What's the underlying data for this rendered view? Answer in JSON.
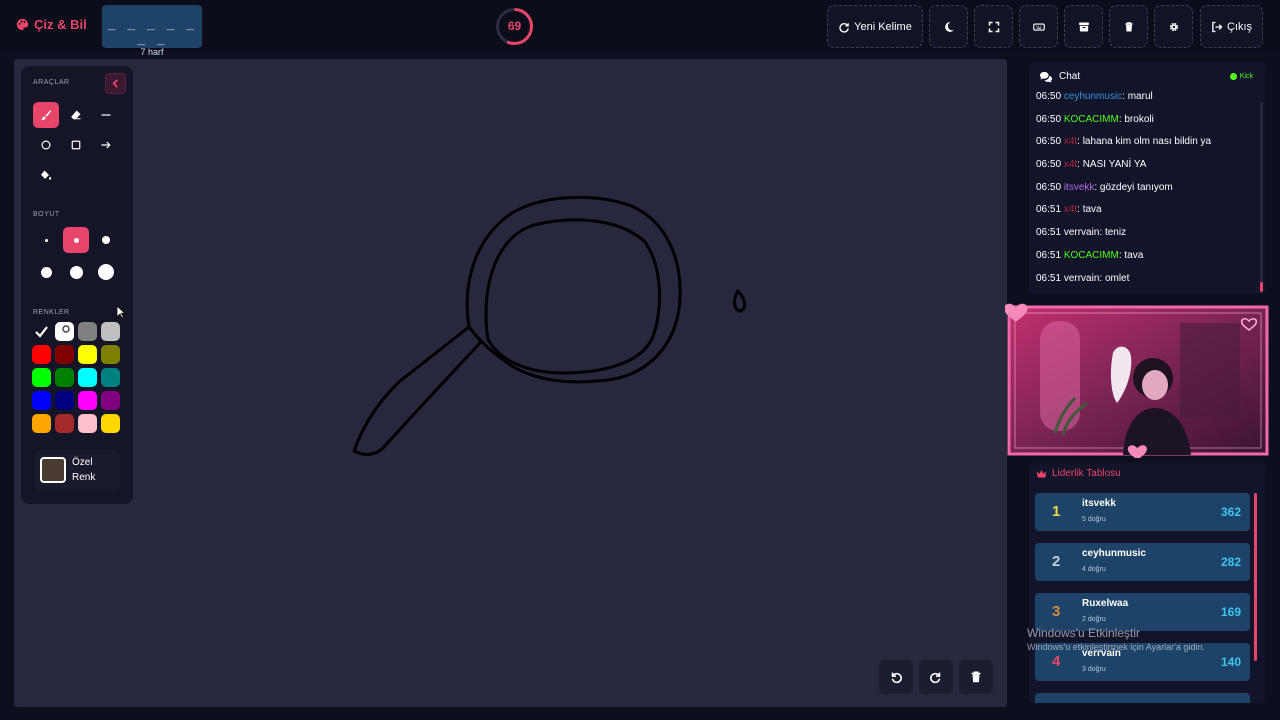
{
  "app": {
    "title": "Çiz & Bil",
    "word_dashes": "_ _ _ _ _ _ _",
    "word_length": "7 harf",
    "timer_value": "69",
    "timer_progress": 0.57
  },
  "toolbar": {
    "new_word_label": "Yeni Kelime",
    "exit_label": "Çıkış",
    "buttons": [
      "refresh-icon",
      "moon-icon",
      "fullscreen-icon",
      "keyboard-icon",
      "archive-icon",
      "trash-icon",
      "gear-icon",
      "sign-out-icon"
    ]
  },
  "tools_panel": {
    "tools_label": "ARAÇLAR",
    "size_label": "BOYUT",
    "colors_label": "RENKLER",
    "custom_color_line1": "Özel",
    "custom_color_line2": "Renk",
    "tools": [
      "brush-icon",
      "eraser-icon",
      "line-icon",
      "circle-icon",
      "square-icon",
      "arrow-icon",
      "fill-icon"
    ],
    "active_tool": "brush",
    "sizes": [
      2,
      4,
      7,
      10,
      12,
      15
    ],
    "active_size": 4,
    "colors": [
      "#000000",
      "#ffffff",
      "#808080",
      "#c0c0c0",
      "#ff0000",
      "#800000",
      "#ffff00",
      "#808000",
      "#00ff00",
      "#008000",
      "#00ffff",
      "#008080",
      "#0000ff",
      "#000080",
      "#ff00ff",
      "#800080",
      "#ffa500",
      "#a52a2a",
      "#ffc0cb",
      "#ffd700"
    ],
    "selected_color": "#000000",
    "custom_color": "#4a3c32"
  },
  "canvas": {
    "background": "#27283d",
    "stroke_color": "#000000"
  },
  "chat": {
    "title": "Chat",
    "platform": "Kick",
    "messages": [
      {
        "time": "06:50",
        "user": "ceyhunmusic",
        "color": "#3b8ede",
        "text": ": marul"
      },
      {
        "time": "06:50",
        "user": "KOCACIMM",
        "color": "#53fc18",
        "text": ": brokoli"
      },
      {
        "time": "06:50",
        "user": "x4t",
        "color": "#b0243c",
        "text": ": lahana kim olm nası bildin ya"
      },
      {
        "time": "06:50",
        "user": "x4t",
        "color": "#b0243c",
        "text": ": NASI YANİ YA"
      },
      {
        "time": "06:50",
        "user": "itsvekk",
        "color": "#b36ae2",
        "text": ": gözdeyi tanıyom"
      },
      {
        "time": "06:51",
        "user": "x4t",
        "color": "#b0243c",
        "text": ": tava"
      },
      {
        "time": "06:51",
        "user": "verrvain",
        "color": "#ffffff",
        "text": ": teniz"
      },
      {
        "time": "06:51",
        "user": "KOCACIMM",
        "color": "#53fc18",
        "text": ": tava"
      },
      {
        "time": "06:51",
        "user": "verrvain",
        "color": "#ffffff",
        "text": ": omlet"
      }
    ]
  },
  "leaderboard": {
    "title": "Liderlik Tablosu",
    "rows": [
      {
        "rank": "1",
        "name": "itsvekk",
        "sub": "5 doğru",
        "score": "362",
        "rank_color": "#f5d742"
      },
      {
        "rank": "2",
        "name": "ceyhunmusic",
        "sub": "4 doğru",
        "score": "282",
        "rank_color": "#c8ccd4"
      },
      {
        "rank": "3",
        "name": "Ruxelwaa",
        "sub": "2 doğru",
        "score": "169",
        "rank_color": "#d88a3c"
      },
      {
        "rank": "4",
        "name": "verrvain",
        "sub": "3 doğru",
        "score": "140",
        "rank_color": "#e8456a"
      }
    ]
  },
  "watermark": {
    "line1": "Windows'u Etkinleştir",
    "line2": "Windows'u etkinleştirmek için Ayarlar'a gidin."
  },
  "colors": {
    "accent": "#e8456a",
    "row_bg": "#1d4468",
    "score": "#3fc4f0"
  }
}
